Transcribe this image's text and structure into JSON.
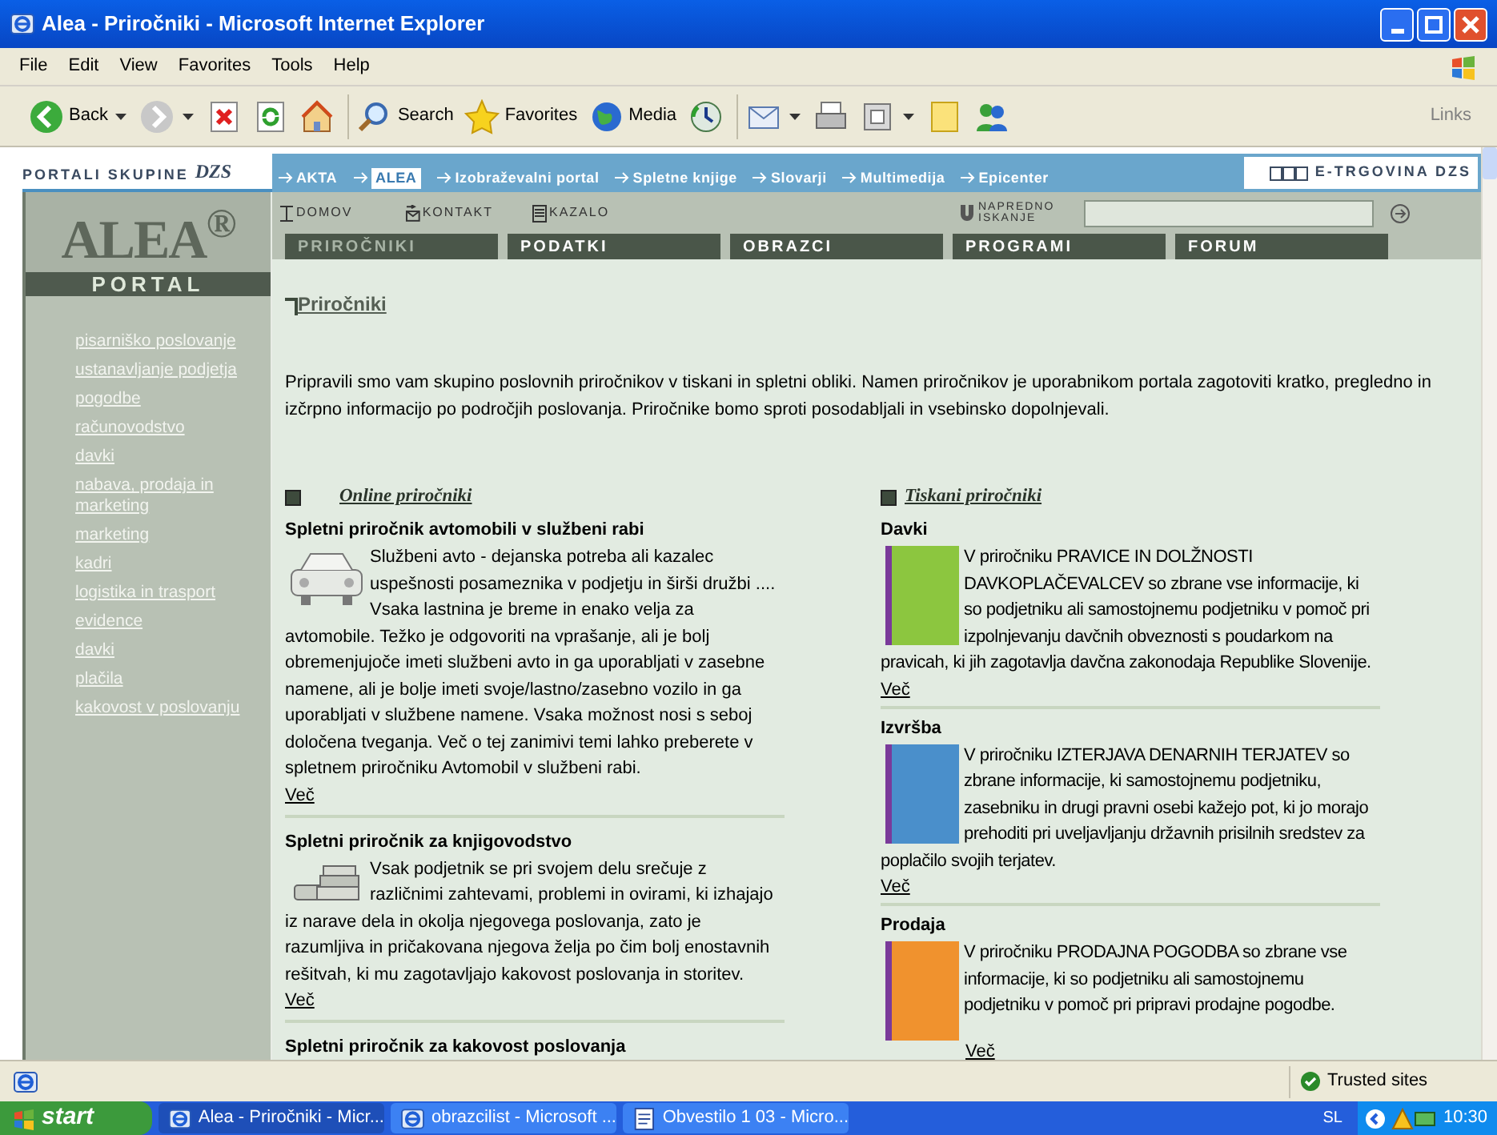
{
  "window": {
    "title": "Alea - Priročniki - Microsoft Internet Explorer"
  },
  "menu_bar": [
    "File",
    "Edit",
    "View",
    "Favorites",
    "Tools",
    "Help"
  ],
  "toolbar": {
    "buttons": [
      {
        "kind": "back",
        "label": "Back"
      },
      {
        "kind": "forward"
      },
      {
        "kind": "stop"
      },
      {
        "kind": "refresh"
      },
      {
        "kind": "home"
      },
      {
        "kind": "search",
        "label": "Search"
      },
      {
        "kind": "favorites",
        "label": "Favorites"
      },
      {
        "kind": "media",
        "label": "Media"
      },
      {
        "kind": "history"
      },
      {
        "kind": "mail"
      },
      {
        "kind": "print"
      },
      {
        "kind": "edit"
      },
      {
        "kind": "note"
      },
      {
        "kind": "messenger"
      }
    ],
    "links_label": "Links"
  },
  "portal_bar": {
    "group_label": "PORTALI SKUPINE",
    "logo": "DZS",
    "links": [
      {
        "label": "AKTA",
        "selected": false
      },
      {
        "label": "ALEA",
        "selected": true
      },
      {
        "label": "Izobraževalni portal",
        "selected": false
      },
      {
        "label": "Spletne knjige",
        "selected": false
      },
      {
        "label": "Slovarji",
        "selected": false
      },
      {
        "label": "Multimedija",
        "selected": false
      },
      {
        "label": "Epicenter",
        "selected": false
      }
    ],
    "shop": "E-TRGOVINA DZS"
  },
  "sidebar": {
    "logo": "ALEA$^{®}$",
    "logo_band": "PORTAL",
    "items": [
      "pisarniško poslovanje",
      "ustanavljanje podjetja",
      "pogodbe",
      "računovodstvo",
      "davki",
      "nabava, prodaja in marketing",
      "marketing",
      "kadri",
      "logistika in trasport",
      "evidence",
      "davki",
      "plačila",
      "kakovost v poslovanju"
    ]
  },
  "nav": {
    "links": [
      {
        "kind": "home",
        "label": "DOMOV"
      },
      {
        "kind": "contact",
        "label": "KONTAKT"
      },
      {
        "kind": "index",
        "label": "KAZALO"
      }
    ],
    "advanced_search": "NAPREDNO ISKANJE"
  },
  "tabs": [
    {
      "label": "PRIROČNIKI",
      "selected": true
    },
    {
      "label": "PODATKI",
      "selected": false
    },
    {
      "label": "OBRAZCI",
      "selected": false
    },
    {
      "label": "PROGRAMI",
      "selected": false
    },
    {
      "label": "FORUM",
      "selected": false
    }
  ],
  "content": {
    "breadcrumb": "Priročniki",
    "intro": "Pripravili smo vam skupino poslovnih priročnikov v tiskani in spletni obliki. Namen priročnikov je uporabnikom portala zagotoviti kratko, pregledno in izčrpno informacijo po področjih poslovanja. Priročnike bomo sproti posodabljali in vsebinsko dopolnjevali.",
    "online": {
      "heading": "Online priročniki",
      "articles": [
        {
          "title": "Spletni priročnik avtomobili v službeni rabi",
          "kind": "car",
          "text": "Službeni avto - dejanska potreba ali kazalec uspešnosti posameznika v podjetju in širši družbi .... Vsaka lastnina je breme in enako velja za avtomobile. Težko je odgovoriti na vprašanje, ali je bolj obremenjujoče imeti službeni avto in ga uporabljati v zasebne namene, ali je bolje imeti svoje/lastno/zasebno vozilo in ga uporabljati v službene namene. Vsaka možnost nosi s seboj določena tveganja. Več o tej zanimivi temi lahko preberete v spletnem priročniku Avtomobil v službeni rabi.",
          "more": "Več"
        },
        {
          "title": "Spletni priročnik za knjigovodstvo",
          "kind": "books",
          "text": "Vsak podjetnik se pri svojem delu srečuje z različnimi zahtevami, problemi in ovirami, ki izhajajo iz narave dela in okolja njegovega poslovanja, zato je razumljiva in pričakovana njegova želja po čim bolj enostavnih rešitvah, ki mu zagotavljajo kakovost poslovanja in storitev.",
          "more": "Več"
        },
        {
          "title": "Spletni priročnik za kakovost poslovanja"
        }
      ]
    },
    "printed": {
      "heading": "Tiskani priročniki",
      "books": [
        {
          "title": "Davki",
          "color": "#8cc63f",
          "text": "V priročniku PRAVICE IN DOLŽNOSTI DAVKOPLAČEVALCEV so zbrane vse informacije, ki so podjetniku ali samostojnemu podjetniku v pomoč pri izpolnjevanju davčnih obveznosti s poudarkom na pravicah, ki jih zagotavlja davčna zakonodaja Republike Slovenije.",
          "more": "Več"
        },
        {
          "title": "Izvršba",
          "color": "#4a8fcb",
          "text": "V priročniku IZTERJAVA DENARNIH TERJATEV so zbrane informacije, ki samostojnemu podjetniku, zasebniku in drugi pravni osebi kažejo pot, ki jo morajo prehoditi pri uveljavljanju državnih prisilnih sredstev za poplačilo svojih terjatev.",
          "more": "Več"
        },
        {
          "title": "Prodaja",
          "color": "#f0922e",
          "text": "V priročniku PRODAJNA POGODBA so zbrane vse informacije, ki so podjetniku ali samostojnemu podjetniku v pomoč pri pripravi prodajne pogodbe.",
          "more": "Več"
        }
      ]
    }
  },
  "status_bar": {
    "zone": "Trusted sites"
  },
  "taskbar": {
    "start": "start",
    "tasks": [
      {
        "label": "Alea - Priročniki - Micr...",
        "kind": "ie",
        "selected": true
      },
      {
        "label": "obrazcilist - Microsoft ...",
        "kind": "ie",
        "selected": false
      },
      {
        "label": "Obvestilo 1 03 - Micro...",
        "kind": "word",
        "selected": false
      }
    ],
    "language": "SL",
    "clock": "10:30"
  }
}
